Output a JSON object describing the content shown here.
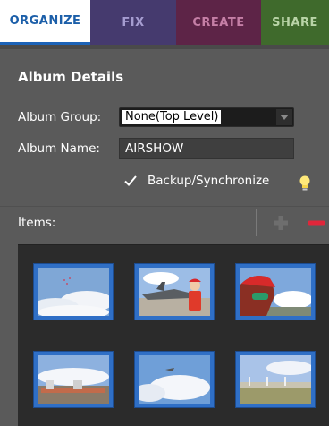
{
  "tabs": {
    "organize": "ORGANIZE",
    "fix": "FIX",
    "create": "CREATE",
    "share": "SHARE"
  },
  "album": {
    "title": "Album Details",
    "group_label": "Album Group:",
    "group_value": "None(Top Level)",
    "name_label": "Album Name:",
    "name_value": "AIRSHOW",
    "backup_label": "Backup/Synchronize",
    "backup_checked": true
  },
  "items": {
    "label": "Items:",
    "add_icon": "plus-icon",
    "remove_icon": "minus-icon"
  },
  "colors": {
    "organize_text": "#1c5fa9",
    "fix_bg": "#453a6e",
    "create_bg": "#5d2447",
    "share_bg": "#3f6a2c",
    "remove_red": "#e0263a",
    "thumb_border": "#2f6fc6",
    "bulb": "#ffe97a"
  }
}
